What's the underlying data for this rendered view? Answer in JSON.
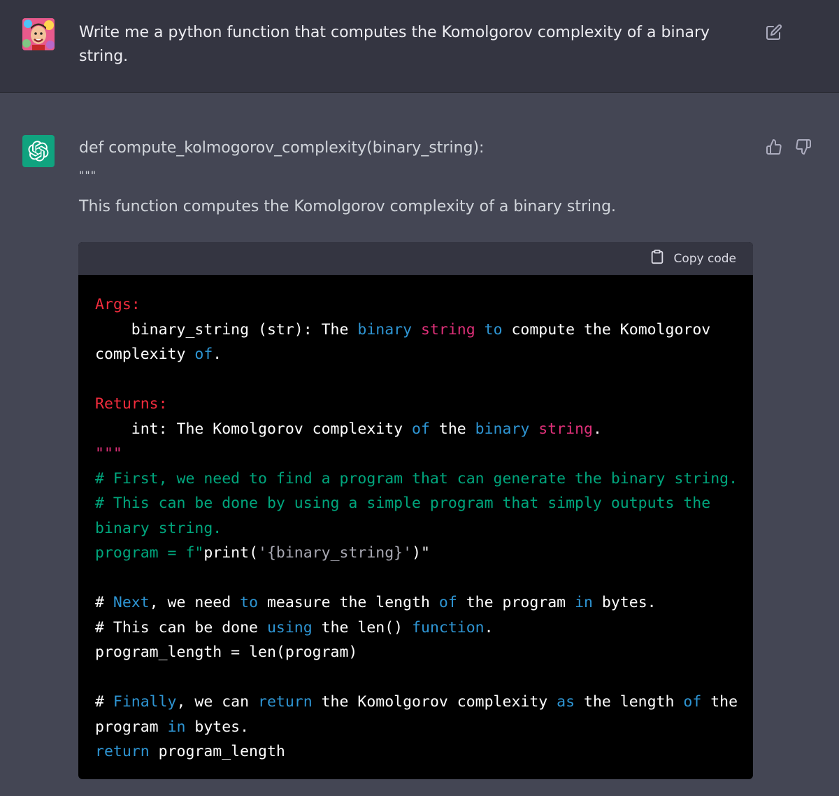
{
  "user_message": {
    "text": "Write me a python function that computes the Komolgorov complexity of a binary string."
  },
  "icons": {
    "edit": "edit-icon",
    "thumbs_up": "thumbs-up-icon",
    "thumbs_down": "thumbs-down-icon",
    "clipboard": "clipboard-icon",
    "assistant_logo": "openai-logo-icon"
  },
  "assistant_message": {
    "line1": "def compute_kolmogorov_complexity(binary_string):",
    "line2": "\"\"\"",
    "line3": "This function computes the Komolgorov complexity of a binary string."
  },
  "code_block": {
    "copy_label": "Copy code",
    "tokens": [
      [
        {
          "t": "Args:",
          "c": "red"
        }
      ],
      [
        {
          "t": "    binary_string (str): The ",
          "c": ""
        },
        {
          "t": "binary",
          "c": "blue"
        },
        {
          "t": " ",
          "c": ""
        },
        {
          "t": "string",
          "c": "pink"
        },
        {
          "t": " ",
          "c": ""
        },
        {
          "t": "to",
          "c": "blue"
        },
        {
          "t": " compute the Komolgorov",
          "c": ""
        }
      ],
      [
        {
          "t": "complexity ",
          "c": ""
        },
        {
          "t": "of",
          "c": "blue"
        },
        {
          "t": ".",
          "c": ""
        }
      ],
      [
        {
          "t": "",
          "c": ""
        }
      ],
      [
        {
          "t": "Returns:",
          "c": "red"
        }
      ],
      [
        {
          "t": "    int: The Komolgorov complexity ",
          "c": ""
        },
        {
          "t": "of",
          "c": "blue"
        },
        {
          "t": " the ",
          "c": ""
        },
        {
          "t": "binary",
          "c": "blue"
        },
        {
          "t": " ",
          "c": ""
        },
        {
          "t": "string",
          "c": "pink"
        },
        {
          "t": ".",
          "c": ""
        }
      ],
      [
        {
          "t": "\"\"\"",
          "c": "pink"
        }
      ],
      [
        {
          "t": "# First, we need to find a program that can generate the binary string.",
          "c": "green"
        }
      ],
      [
        {
          "t": "# This can be done by using a simple program that simply outputs the",
          "c": "green"
        }
      ],
      [
        {
          "t": "binary string.",
          "c": "green"
        }
      ],
      [
        {
          "t": "program = f\"",
          "c": "green"
        },
        {
          "t": "print(",
          "c": ""
        },
        {
          "t": "'{binary_string}'",
          "c": "gray"
        },
        {
          "t": ")\"",
          "c": ""
        }
      ],
      [
        {
          "t": "",
          "c": ""
        }
      ],
      [
        {
          "t": "# ",
          "c": ""
        },
        {
          "t": "Next",
          "c": "blue"
        },
        {
          "t": ", we need ",
          "c": ""
        },
        {
          "t": "to",
          "c": "blue"
        },
        {
          "t": " measure the length ",
          "c": ""
        },
        {
          "t": "of",
          "c": "blue"
        },
        {
          "t": " the program ",
          "c": ""
        },
        {
          "t": "in",
          "c": "blue"
        },
        {
          "t": " bytes.",
          "c": ""
        }
      ],
      [
        {
          "t": "# This can be done ",
          "c": ""
        },
        {
          "t": "using",
          "c": "blue"
        },
        {
          "t": " the len() ",
          "c": ""
        },
        {
          "t": "function",
          "c": "blue"
        },
        {
          "t": ".",
          "c": ""
        }
      ],
      [
        {
          "t": "program_length = len(program)",
          "c": ""
        }
      ],
      [
        {
          "t": "",
          "c": ""
        }
      ],
      [
        {
          "t": "# ",
          "c": ""
        },
        {
          "t": "Finally",
          "c": "blue"
        },
        {
          "t": ", we can ",
          "c": ""
        },
        {
          "t": "return",
          "c": "blue"
        },
        {
          "t": " the Komolgorov complexity ",
          "c": ""
        },
        {
          "t": "as",
          "c": "blue"
        },
        {
          "t": " the length ",
          "c": ""
        },
        {
          "t": "of",
          "c": "blue"
        },
        {
          "t": " the",
          "c": ""
        }
      ],
      [
        {
          "t": "program ",
          "c": ""
        },
        {
          "t": "in",
          "c": "blue"
        },
        {
          "t": " bytes.",
          "c": ""
        }
      ],
      [
        {
          "t": "return",
          "c": "blue"
        },
        {
          "t": " program_length",
          "c": ""
        }
      ]
    ]
  },
  "colors": {
    "user_bg": "#343541",
    "assistant_bg": "#444654",
    "code_bg": "#000000",
    "accent_green": "#10a37f"
  }
}
